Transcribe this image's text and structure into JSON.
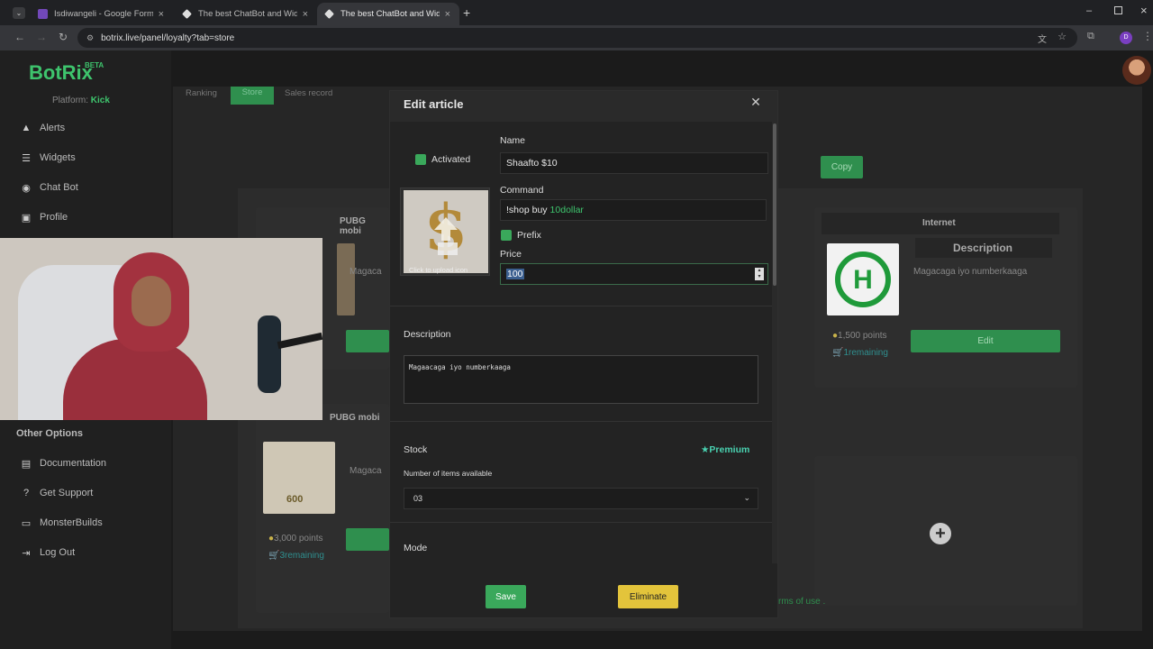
{
  "browser": {
    "tabs": [
      {
        "title": "Isdiwangeli - Google Forms",
        "favicon_color": "#7248b9"
      },
      {
        "title": "The best ChatBot and Widgets",
        "favicon_color": "#dddddd"
      },
      {
        "title": "The best ChatBot and Widgets",
        "favicon_color": "#dddddd"
      }
    ],
    "url": "botrix.live/panel/loyalty?tab=store"
  },
  "sidebar": {
    "logo": "BotRix",
    "beta": "BETA",
    "platform_label": "Platform:",
    "platform_value": "Kick",
    "items": [
      {
        "label": "Alerts",
        "icon": "warning-icon"
      },
      {
        "label": "Widgets",
        "icon": "list-icon"
      },
      {
        "label": "Chat Bot",
        "icon": "robot-icon"
      },
      {
        "label": "Profile",
        "icon": "id-card-icon"
      }
    ],
    "other_options_title": "Other Options",
    "other_items": [
      {
        "label": "Documentation",
        "icon": "document-icon"
      },
      {
        "label": "Get Support",
        "icon": "help-icon"
      },
      {
        "label": "MonsterBuilds",
        "icon": "monitor-icon"
      },
      {
        "label": "Log Out",
        "icon": "logout-icon"
      }
    ]
  },
  "background": {
    "tabs": [
      "Ranking",
      "Store",
      "Sales record"
    ],
    "copy_button": "Copy",
    "cards": [
      {
        "title": "PUBG mobi",
        "desc": "Magaca",
        "points": "",
        "remaining": ""
      },
      {
        "title": "PUBG mobi",
        "desc": "Magaca",
        "points": "3,000 points",
        "remaining": "3remaining",
        "thumb_text": "600"
      },
      {
        "title": "Internet",
        "desc_title": "Description",
        "desc": "Magacaga iyo numberkaaga",
        "points": "1,500 points",
        "remaining": "1remaining",
        "edit": "Edit"
      }
    ],
    "terms_text": "rms of use ."
  },
  "modal": {
    "title": "Edit article",
    "activated_label": "Activated",
    "upload_hint": "Click to upload icon",
    "name_label": "Name",
    "name_value": "Shaafto $10",
    "command_label": "Command",
    "command_prefix": "!shop buy",
    "command_suffix": "10dollar",
    "prefix_label": "Prefix",
    "price_label": "Price",
    "price_value": "100",
    "description_label": "Description",
    "description_value": "Magaacaga iyo numberkaaga",
    "stock_label": "Stock",
    "premium_label": "Premium",
    "stock_sub_label": "Number of items available",
    "stock_value": "03",
    "mode_label": "Mode",
    "save_label": "Save",
    "eliminate_label": "Eliminate"
  },
  "colors": {
    "accent_green": "#3ec46d",
    "button_green": "#3aa85b",
    "button_yellow": "#e3c43b"
  }
}
